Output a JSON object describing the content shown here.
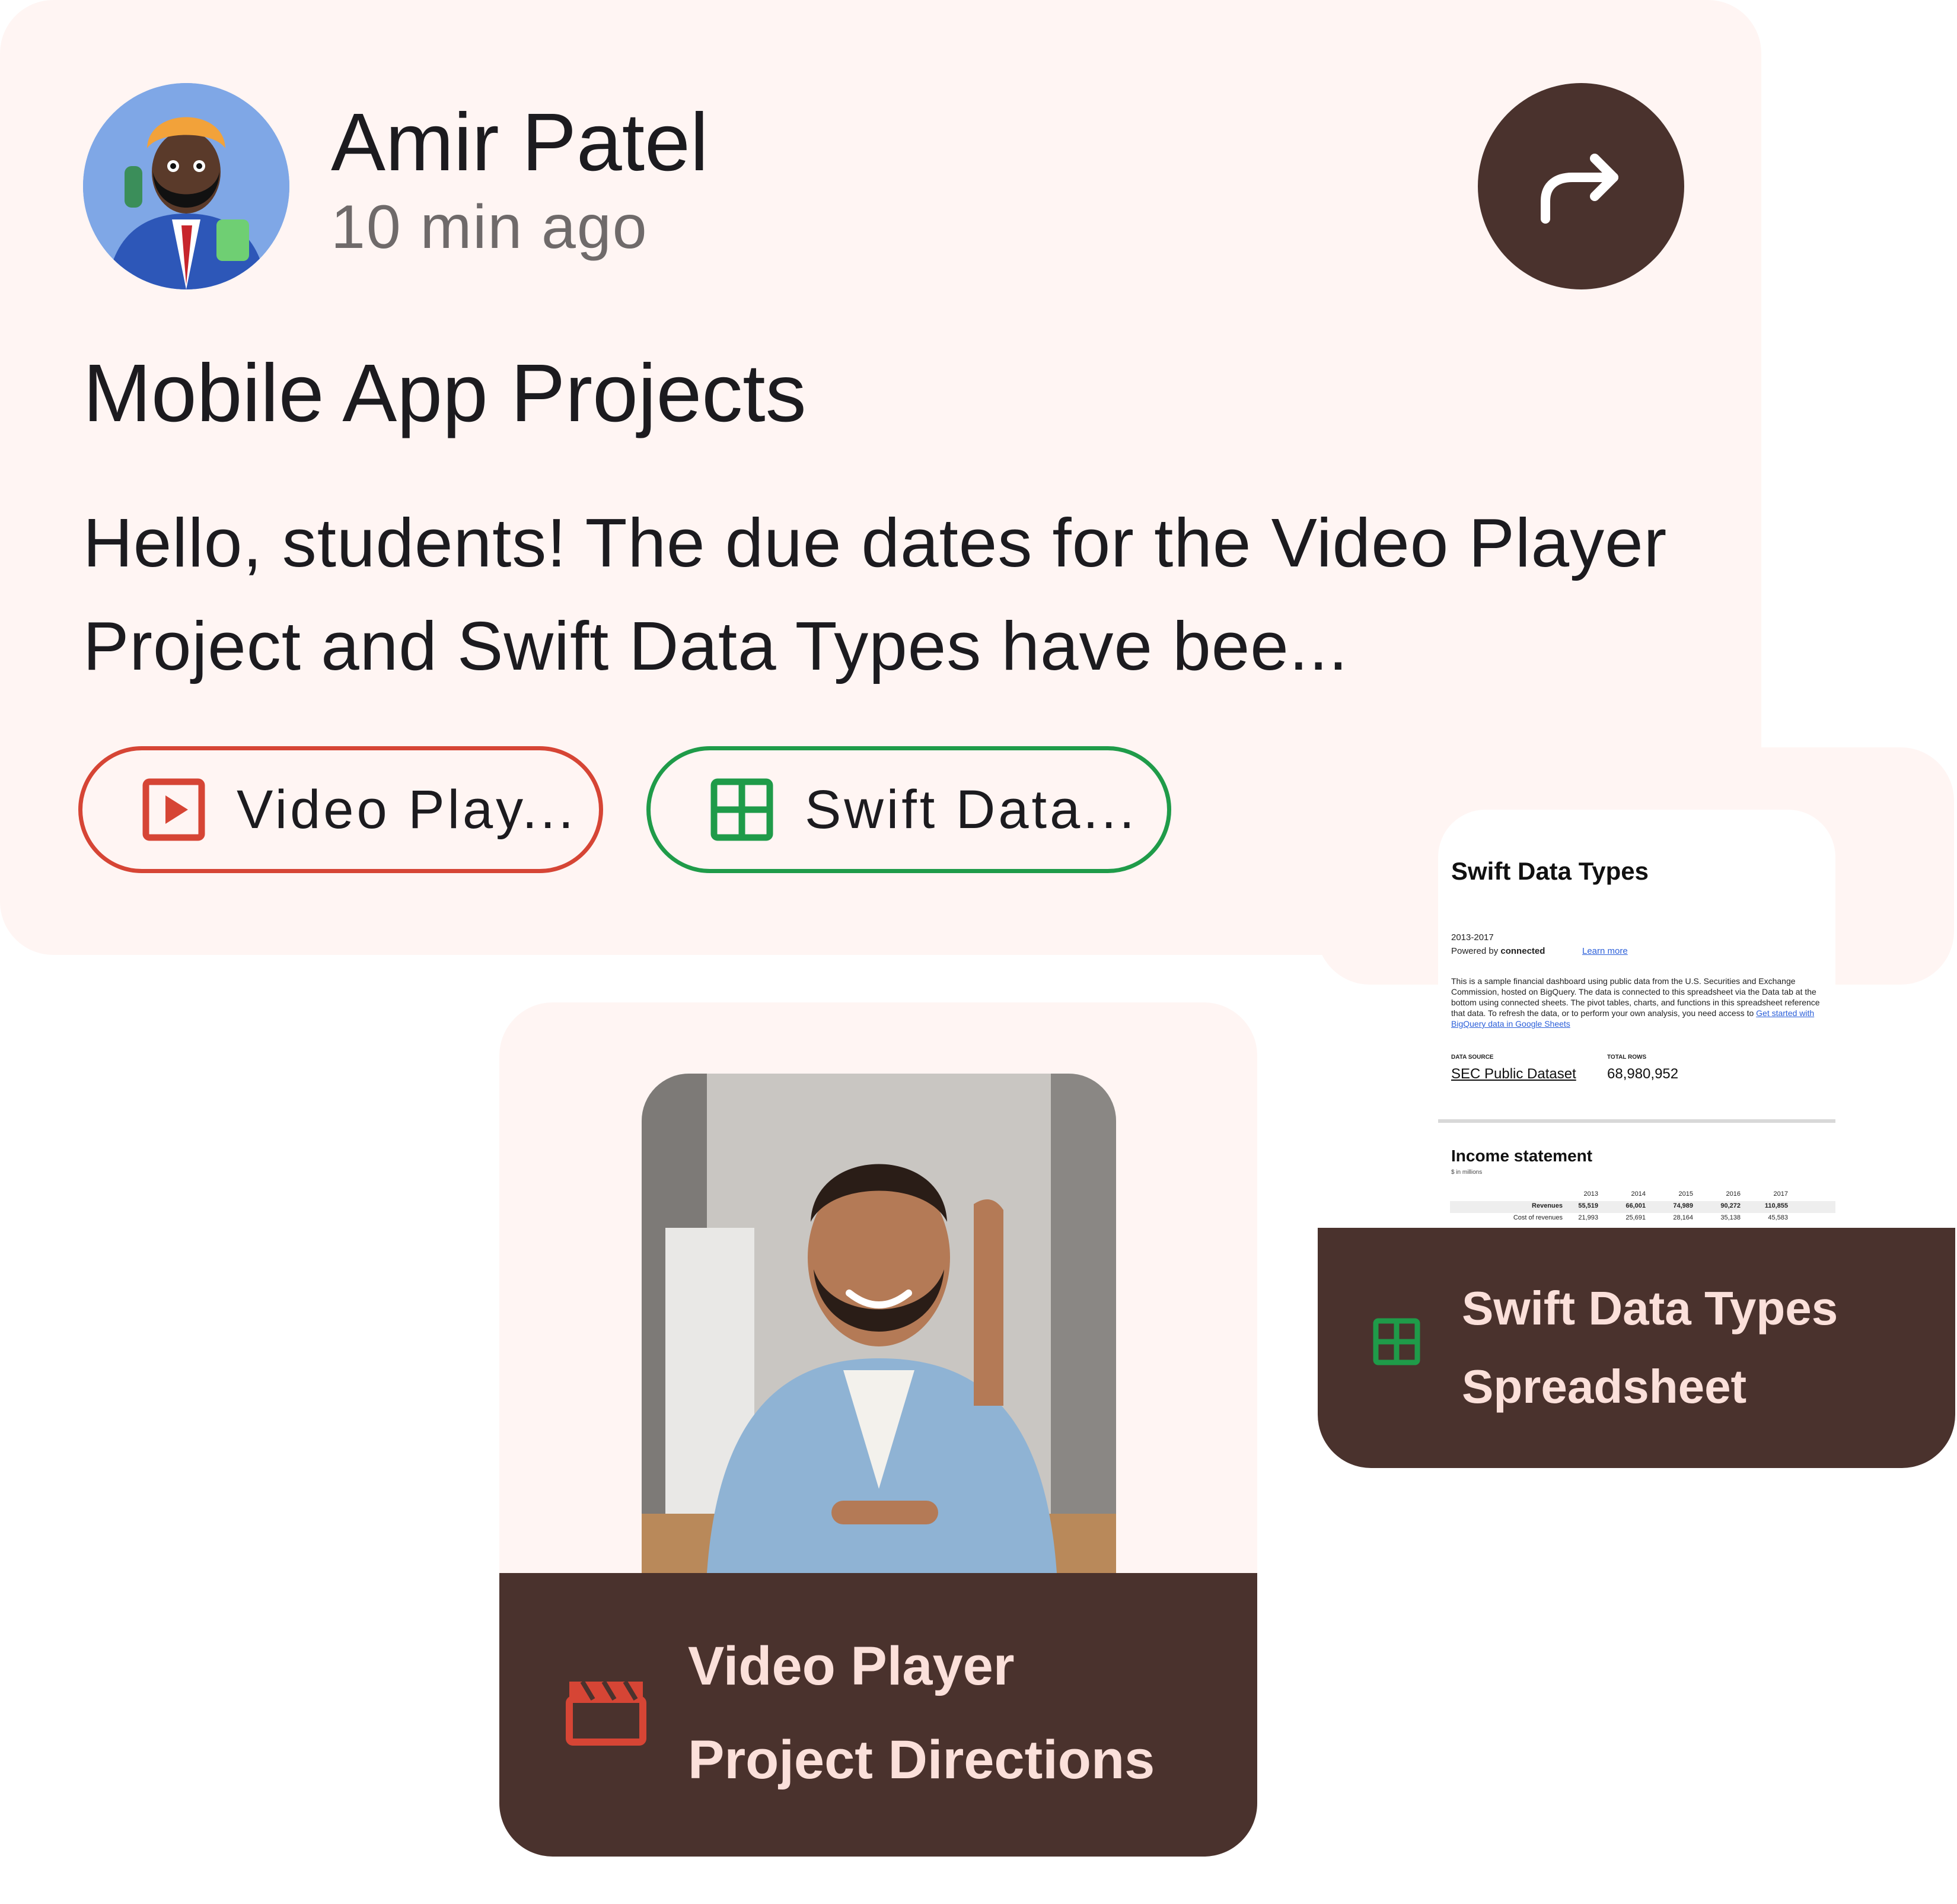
{
  "post": {
    "author_name": "Amir Patel",
    "timestamp": "10 min ago",
    "title": "Mobile App Projects",
    "body": "Hello, students! The due dates for the Video Player Project and Swift Data Types have bee...",
    "share_icon": "share-arrow-icon",
    "chips": [
      {
        "label": "Video Play...",
        "icon": "video-play-icon",
        "color": "#d64535"
      },
      {
        "label": "Swift Data...",
        "icon": "spreadsheet-grid-icon",
        "color": "#1f9b49"
      }
    ]
  },
  "attachments": {
    "video": {
      "title_line1": "Video Player",
      "title_line2": "Project Directions",
      "icon": "clapperboard-icon",
      "icon_color": "#d64535"
    },
    "sheet": {
      "title_line1": "Swift Data Types",
      "title_line2": "Spreadsheet",
      "icon": "spreadsheet-grid-icon",
      "icon_color": "#1f9b49",
      "preview": {
        "title": "Swift Data Types",
        "years": "2013-2017",
        "powered_prefix": "Powered by",
        "powered_bold": "connected",
        "learn_more": "Learn more",
        "paragraph": "This is a sample financial dashboard using public data from the U.S. Securities and Exchange Commission, hosted on BigQuery. The data is connected to this spreadsheet via the Data tab at the bottom using connected sheets. The pivot tables, charts, and functions in this spreadsheet reference that data. To refresh the data, or to perform your own analysis, you need access to",
        "paragraph_link": "Get started with BigQuery data in Google Sheets",
        "data_source_label": "DATA SOURCE",
        "data_source_value": "SEC Public Dataset",
        "total_rows_label": "TOTAL ROWS",
        "total_rows_value": "68,980,952",
        "section_heading": "Income statement",
        "section_sub": "$ in millions",
        "years_header": [
          "2013",
          "2014",
          "2015",
          "2016",
          "2017"
        ],
        "rows": [
          {
            "label": "Revenues",
            "values": [
              "55,519",
              "66,001",
              "74,989",
              "90,272",
              "110,855"
            ]
          },
          {
            "label": "Cost of revenues",
            "values": [
              "21,993",
              "25,691",
              "28,164",
              "35,138",
              "45,583"
            ]
          }
        ]
      }
    }
  },
  "colors": {
    "card_background": "#fff5f3",
    "dark_brown": "#4a322d",
    "footer_text": "#fbe0da",
    "red_accent": "#d64535",
    "green_accent": "#1f9b49"
  }
}
